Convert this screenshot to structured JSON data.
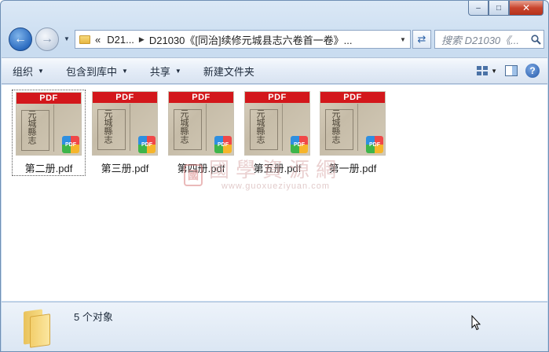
{
  "window": {
    "caption": {
      "minimize": "–",
      "maximize": "□",
      "close": "✕"
    }
  },
  "nav": {
    "back_icon": "arrow-left-icon",
    "forward_icon": "arrow-right-icon"
  },
  "address": {
    "prefix": "«",
    "crumb1": "D21...",
    "crumb2": "D21030《[同治]续修元城县志六卷首一卷》..."
  },
  "search": {
    "placeholder": "搜索 D21030《..."
  },
  "toolbar": {
    "organize": "组织",
    "include_library": "包含到库中",
    "share": "共享",
    "new_folder": "新建文件夹"
  },
  "files": [
    {
      "name": "第二册.pdf",
      "selected": true
    },
    {
      "name": "第三册.pdf",
      "selected": false
    },
    {
      "name": "第四册.pdf",
      "selected": false
    },
    {
      "name": "第五册.pdf",
      "selected": false
    },
    {
      "name": "第一册.pdf",
      "selected": false
    }
  ],
  "thumbnail": {
    "banner": "PDF",
    "calligraphy": "元城縣志",
    "badge": "PDF"
  },
  "watermark": {
    "logo": "國",
    "text": "國學資源網",
    "url": "www.guoxueziyuan.com"
  },
  "status": {
    "count_text": "5 个对象"
  },
  "colors": {
    "pdf_banner": "#d3171b",
    "accent": "#2c6cc0"
  }
}
